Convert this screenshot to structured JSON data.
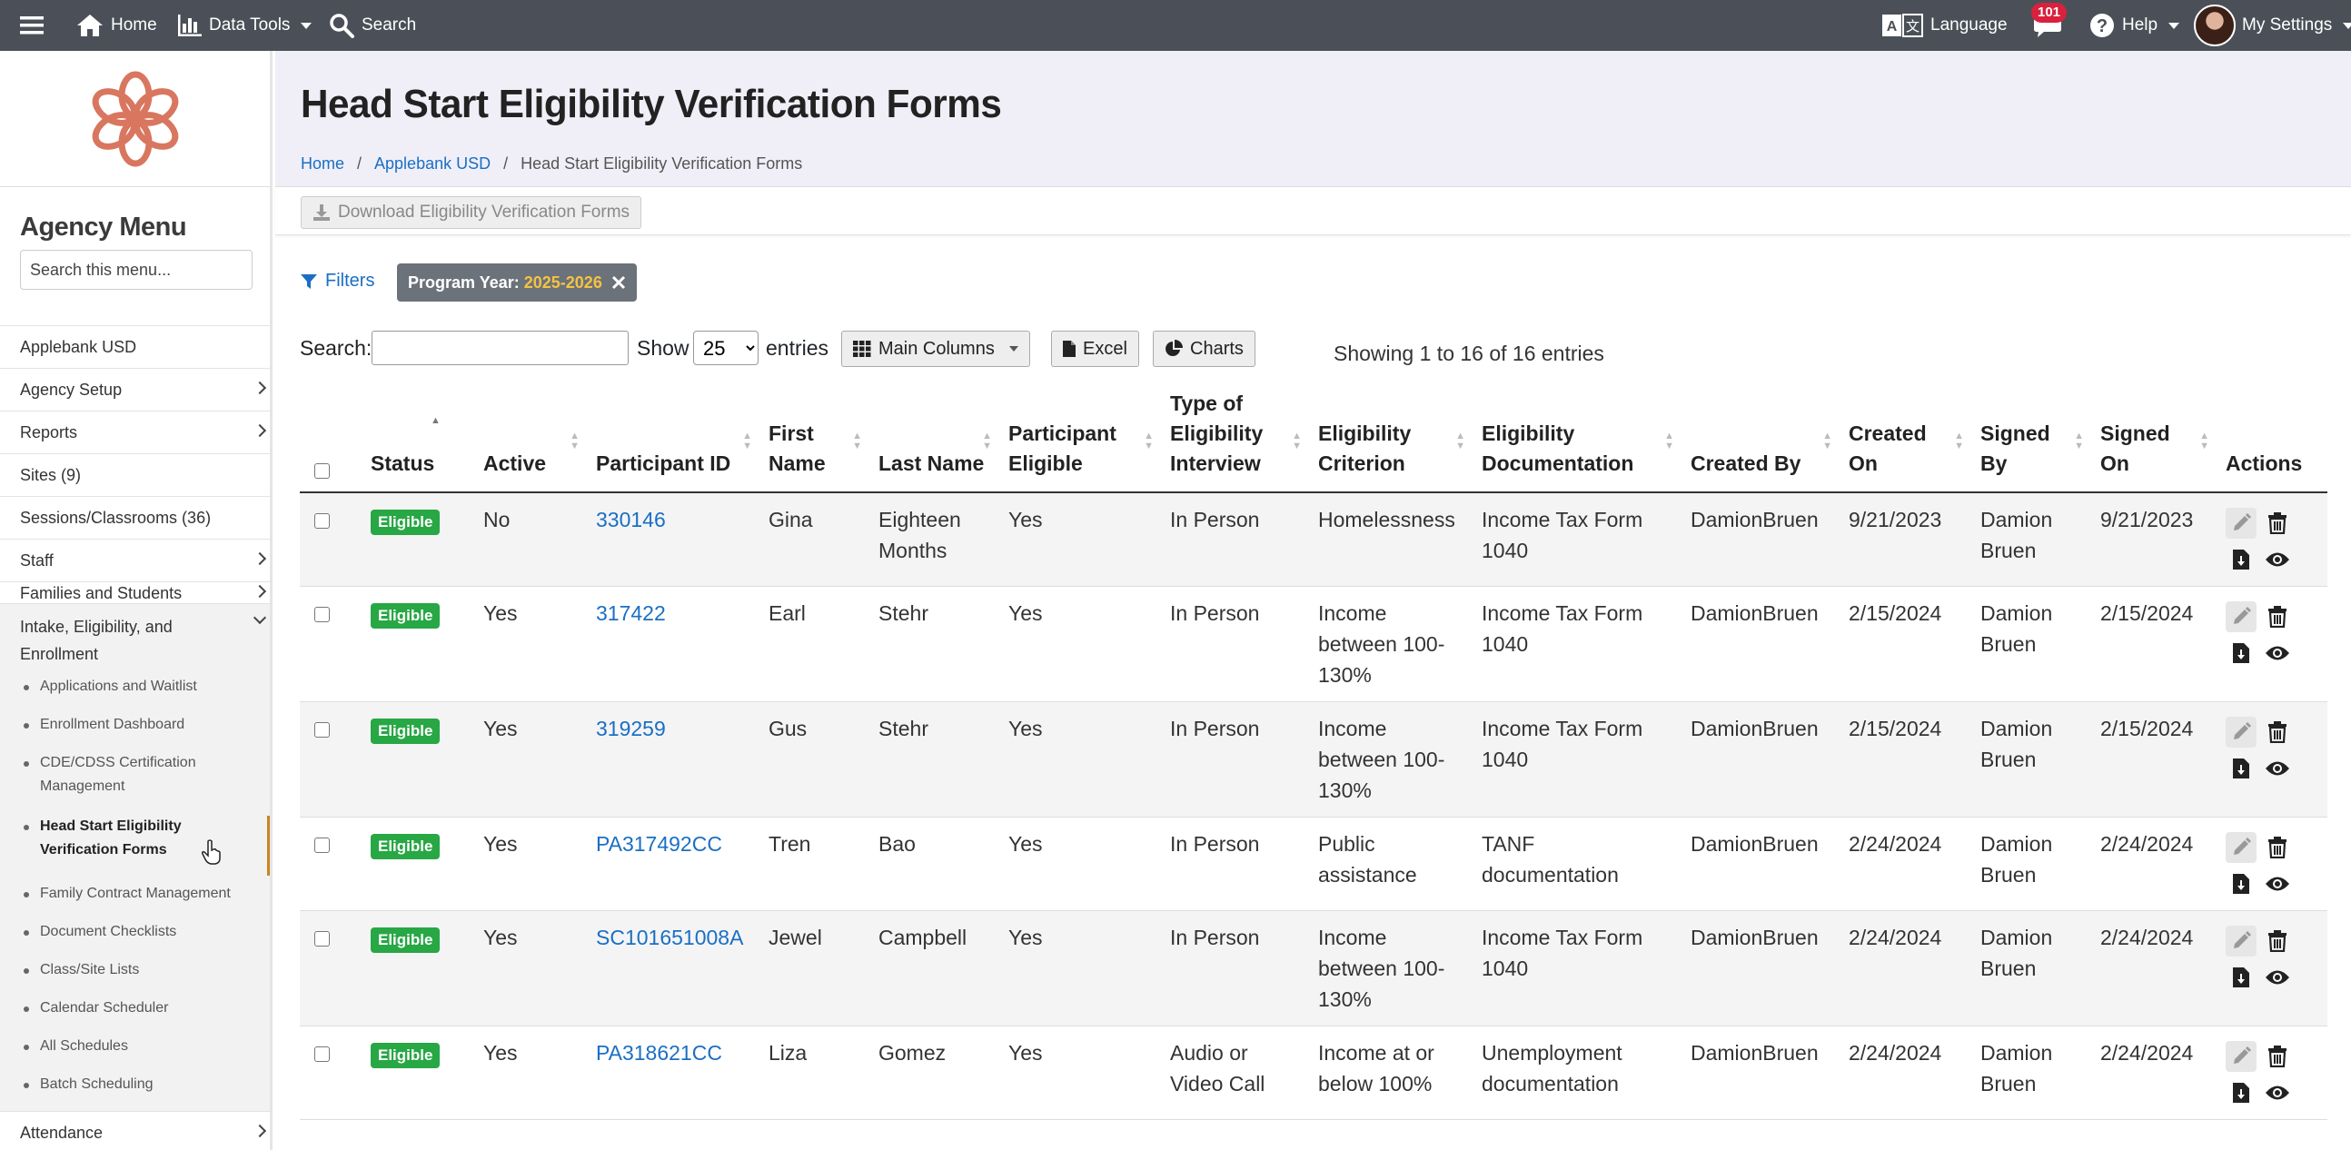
{
  "navbar": {
    "home": "Home",
    "data_tools": "Data Tools",
    "search": "Search",
    "language": "Language",
    "notifications_count": "101",
    "help": "Help",
    "my_settings": "My Settings"
  },
  "sidebar": {
    "title": "Agency Menu",
    "search_placeholder": "Search this menu...",
    "items": [
      {
        "label": "Applebank USD"
      },
      {
        "label": "Agency Setup"
      },
      {
        "label": "Reports"
      },
      {
        "label": "Sites (9)"
      },
      {
        "label": "Sessions/Classrooms (36)"
      },
      {
        "label": "Staff"
      },
      {
        "label": "Families and Students"
      }
    ],
    "intake": {
      "label": "Intake, Eligibility, and Enrollment",
      "subitems": [
        "Applications and Waitlist",
        "Enrollment Dashboard",
        "CDE/CDSS Certification Management",
        "Head Start Eligibility Verification Forms",
        "Family Contract Management",
        "Document Checklists",
        "Class/Site Lists",
        "Calendar Scheduler",
        "All Schedules",
        "Batch Scheduling"
      ]
    },
    "attendance": "Attendance"
  },
  "page": {
    "title": "Head Start Eligibility Verification Forms",
    "breadcrumb": [
      "Home",
      "Applebank USD",
      "Head Start Eligibility Verification Forms"
    ],
    "download_label": "Download Eligibility Verification Forms",
    "filters_label": "Filters",
    "filter_chip_key": "Program Year:",
    "filter_chip_value": "2025-2026",
    "search_label": "Search:",
    "show_label": "Show",
    "entries_value": "25",
    "entries_label": "entries",
    "main_columns_label": "Main Columns",
    "excel_label": "Excel",
    "charts_label": "Charts",
    "showing_info": "Showing 1 to 16 of 16 entries"
  },
  "table": {
    "headers": {
      "status": "Status",
      "active": "Active",
      "participant_id": "Participant ID",
      "first_name": "First Name",
      "last_name": "Last Name",
      "participant_eligible": "Participant Eligible",
      "interview_type": "Type of Eligibility Interview",
      "criterion": "Eligibility Criterion",
      "documentation": "Eligibility Documentation",
      "created_by": "Created By",
      "created_on": "Created On",
      "signed_by": "Signed By",
      "signed_on": "Signed On",
      "actions": "Actions"
    },
    "rows": [
      {
        "status": "Eligible",
        "active": "No",
        "participant_id": "330146",
        "first_name": "Gina",
        "last_name": "Eighteen Months",
        "eligible": "Yes",
        "interview": "In Person",
        "criterion": "Homelessness",
        "documentation": "Income Tax Form 1040",
        "created_by": "DamionBruen",
        "created_on": "9/21/2023",
        "signed_by": "Damion Bruen",
        "signed_on": "9/21/2023"
      },
      {
        "status": "Eligible",
        "active": "Yes",
        "participant_id": "317422",
        "first_name": "Earl",
        "last_name": "Stehr",
        "eligible": "Yes",
        "interview": "In Person",
        "criterion": "Income between 100-130%",
        "documentation": "Income Tax Form 1040",
        "created_by": "DamionBruen",
        "created_on": "2/15/2024",
        "signed_by": "Damion Bruen",
        "signed_on": "2/15/2024"
      },
      {
        "status": "Eligible",
        "active": "Yes",
        "participant_id": "319259",
        "first_name": "Gus",
        "last_name": "Stehr",
        "eligible": "Yes",
        "interview": "In Person",
        "criterion": "Income between 100-130%",
        "documentation": "Income Tax Form 1040",
        "created_by": "DamionBruen",
        "created_on": "2/15/2024",
        "signed_by": "Damion Bruen",
        "signed_on": "2/15/2024"
      },
      {
        "status": "Eligible",
        "active": "Yes",
        "participant_id": "PA317492CC",
        "first_name": "Tren",
        "last_name": "Bao",
        "eligible": "Yes",
        "interview": "In Person",
        "criterion": "Public assistance",
        "documentation": "TANF documentation",
        "created_by": "DamionBruen",
        "created_on": "2/24/2024",
        "signed_by": "Damion Bruen",
        "signed_on": "2/24/2024"
      },
      {
        "status": "Eligible",
        "active": "Yes",
        "participant_id": "SC101651008A",
        "first_name": "Jewel",
        "last_name": "Campbell",
        "eligible": "Yes",
        "interview": "In Person",
        "criterion": "Income between 100-130%",
        "documentation": "Income Tax Form 1040",
        "created_by": "DamionBruen",
        "created_on": "2/24/2024",
        "signed_by": "Damion Bruen",
        "signed_on": "2/24/2024"
      },
      {
        "status": "Eligible",
        "active": "Yes",
        "participant_id": "PA318621CC",
        "first_name": "Liza",
        "last_name": "Gomez",
        "eligible": "Yes",
        "interview": "Audio or Video Call",
        "criterion": "Income at or below 100%",
        "documentation": "Unemployment documentation",
        "created_by": "DamionBruen",
        "created_on": "2/24/2024",
        "signed_by": "Damion Bruen",
        "signed_on": "2/24/2024"
      }
    ]
  },
  "colors": {
    "navbar": "#4b5058",
    "link": "#1a6fc4",
    "eligible_badge": "#28a745",
    "logo": "#d9765f",
    "notification_badge": "#d9213d",
    "filter_year": "#f5c342"
  }
}
